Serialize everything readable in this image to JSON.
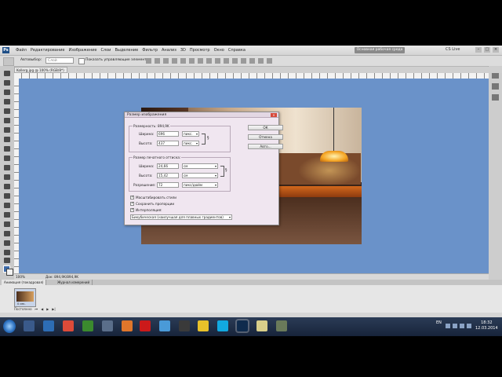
{
  "menubar": {
    "logo": "Ps",
    "items": [
      "Файл",
      "Редактирование",
      "Изображение",
      "Слои",
      "Выделение",
      "Фильтр",
      "Анализ",
      "3D",
      "Просмотр",
      "Окно",
      "Справка"
    ],
    "workspace_button": "Основная рабочая среда",
    "cs_live": "CS Live"
  },
  "options_bar": {
    "autoselect_label": "Автовыбор:",
    "autoselect_value": "Слой",
    "show_controls_label": "Показать управляющие элементы"
  },
  "document": {
    "tab_label": "Kollerg.jpg @ 100% (RGB/8*)"
  },
  "dialog": {
    "title": "Размер изображения",
    "close_icon": "close-icon",
    "pixel_dims_label": "Размерность:",
    "pixel_dims_value": "894,9K",
    "width_label": "Ширина:",
    "width_value": "696",
    "width_unit": "пикс.",
    "height_label": "Высота:",
    "height_value": "437",
    "height_unit": "пикс.",
    "print_group_label": "Размер печатного оттиска:",
    "print_width_label": "Ширина:",
    "print_width_value": "24,66",
    "print_width_unit": "см",
    "print_height_label": "Высота:",
    "print_height_value": "15,42",
    "print_height_unit": "см",
    "resolution_label": "Разрешение:",
    "resolution_value": "72",
    "resolution_unit": "пикс/дюйм",
    "scale_styles_label": "Масштабировать стили",
    "constrain_label": "Сохранить пропорции",
    "resample_label": "Интерполяция:",
    "resample_method": "Бикубическая (наилучшая для плавных градиентов)",
    "ok_button": "ОК",
    "cancel_button": "Отмена",
    "auto_button": "Авто..."
  },
  "statusbar": {
    "zoom": "100%",
    "doc_info": "Док: 894,9K/894,9K"
  },
  "animation": {
    "tab_active": "Анимация (покадровая)",
    "tab_other": "Журнал измерений",
    "frame_time": "0 сек.",
    "loop": "Постоянно"
  },
  "taskbar": {
    "lang": "EN",
    "time": "18:32",
    "date": "12.03.2014"
  }
}
